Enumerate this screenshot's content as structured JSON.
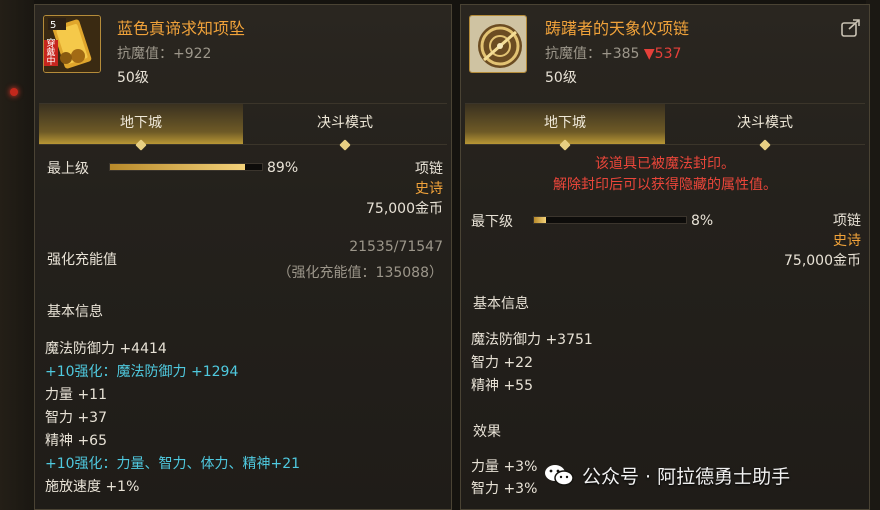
{
  "left": {
    "name": "蓝色真谛求知项坠",
    "resist": "抗魔值：+922",
    "level": "50级",
    "icon_tag": "穿戴中",
    "tabs": [
      "地下城",
      "决斗模式"
    ],
    "grade_label": "最上级",
    "grade_percent": "89%",
    "grade_fill": 0.89,
    "item_type": "项链",
    "rarity": "史诗",
    "price": "75,000金币",
    "charge_label": "强化充能值",
    "charge_value": "21535/71547",
    "charge_note": "（强化充能值：135088）",
    "section_title": "基本信息",
    "stats": [
      {
        "text": "魔法防御力 +4414",
        "color": "white"
      },
      {
        "text": "+10强化：魔法防御力 +1294",
        "color": "cyan"
      },
      {
        "text": "力量 +11",
        "color": "white"
      },
      {
        "text": "智力 +37",
        "color": "white"
      },
      {
        "text": "精神 +65",
        "color": "white"
      },
      {
        "text": "+10强化：力量、智力、体力、精神+21",
        "color": "cyan"
      },
      {
        "text": "施放速度 +1%",
        "color": "white"
      }
    ]
  },
  "right": {
    "name": "踌躇者的天象仪项链",
    "resist_prefix": "抗魔值：+385",
    "resist_down": "▼537",
    "level": "50级",
    "tabs": [
      "地下城",
      "决斗模式"
    ],
    "sealed_line1": "该道具已被魔法封印。",
    "sealed_line2": "解除封印后可以获得隐藏的属性值。",
    "grade_label": "最下级",
    "grade_percent": "8%",
    "grade_fill": 0.08,
    "item_type": "项链",
    "rarity": "史诗",
    "price": "75,000金币",
    "section_title": "基本信息",
    "stats": [
      "魔法防御力 +3751",
      "智力 +22",
      "精神 +55"
    ],
    "effect_title": "效果",
    "effects": [
      "力量 +3%",
      "智力 +3%"
    ]
  },
  "watermark": "公众号 · 阿拉德勇士助手",
  "colors": {
    "item_name": "#f0a23a",
    "epic": "#f0a23a",
    "enhance_cyan": "#4fc9df",
    "sealed_red": "#ea463a",
    "down_red": "#e5403a"
  },
  "icons": {
    "left": "blue-scroll-pendant-icon",
    "right": "astrolabe-necklace-icon",
    "compare": "external-compare-icon",
    "watermark": "wechat-icon"
  }
}
